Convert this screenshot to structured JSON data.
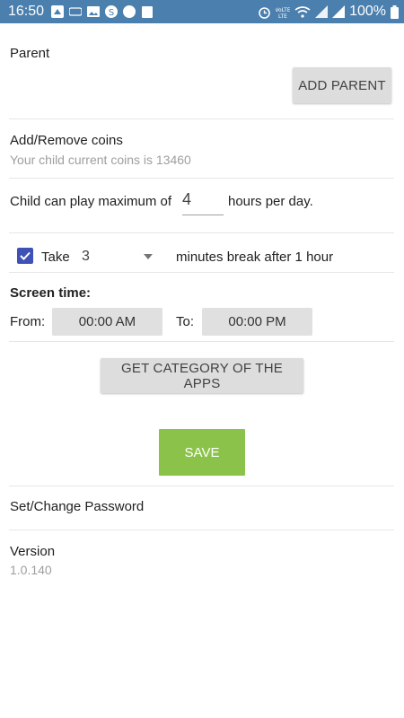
{
  "status_bar": {
    "time": "16:50",
    "battery": "100%",
    "icons_left": [
      "notification-icon",
      "vpn-icon",
      "image-icon",
      "skype-icon",
      "messaging-icon",
      "calendar-icon"
    ],
    "icons_right": [
      "alarm-icon",
      "volte-icon",
      "wifi-icon",
      "signal-icon",
      "signal-icon",
      "battery-icon"
    ]
  },
  "parent": {
    "title": "Parent",
    "add_button": "ADD PARENT"
  },
  "coins": {
    "title": "Add/Remove coins",
    "subtitle": "Your child current coins is 13460"
  },
  "play_limit": {
    "prefix": "Child can play maximum of",
    "value": "4",
    "suffix": "hours per day."
  },
  "break": {
    "checked": true,
    "take_label": "Take",
    "minutes_value": "3",
    "suffix": "minutes break after 1 hour"
  },
  "screen_time": {
    "title": "Screen time:",
    "from_label": "From:",
    "from_value": "00:00 AM",
    "to_label": "To:",
    "to_value": "00:00 PM"
  },
  "category_button": "GET CATEGORY OF THE APPS",
  "save_button": "SAVE",
  "password": {
    "label": "Set/Change Password"
  },
  "version": {
    "label": "Version",
    "value": "1.0.140"
  },
  "colors": {
    "status_bar": "#4a7fae",
    "save": "#8bc34a",
    "checkbox": "#3f51b5"
  }
}
